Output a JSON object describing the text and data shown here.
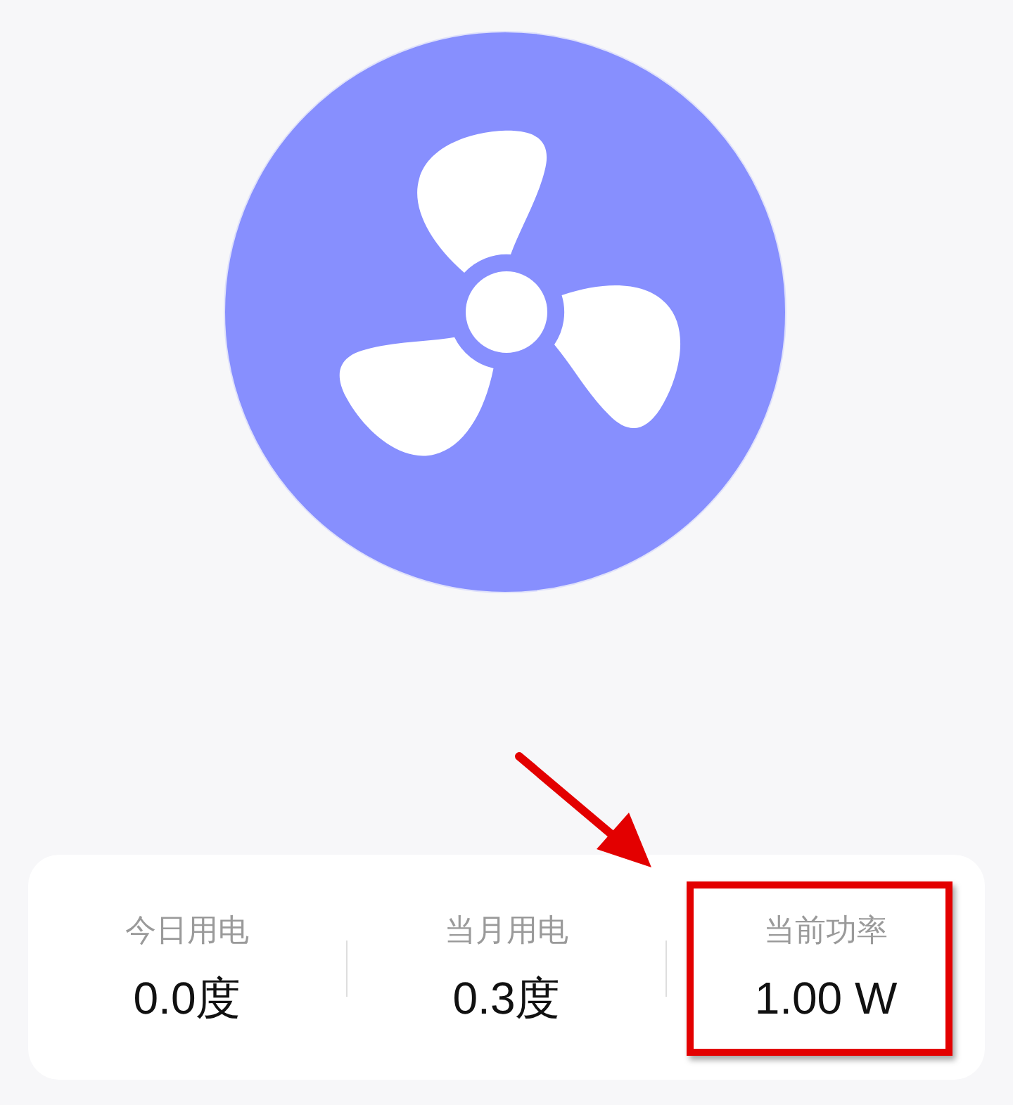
{
  "stats": [
    {
      "label": "今日用电",
      "value": "0.0度",
      "highlighted": false
    },
    {
      "label": "当月用电",
      "value": "0.3度",
      "highlighted": false
    },
    {
      "label": "当前功率",
      "value": "1.00 W",
      "highlighted": true
    }
  ]
}
